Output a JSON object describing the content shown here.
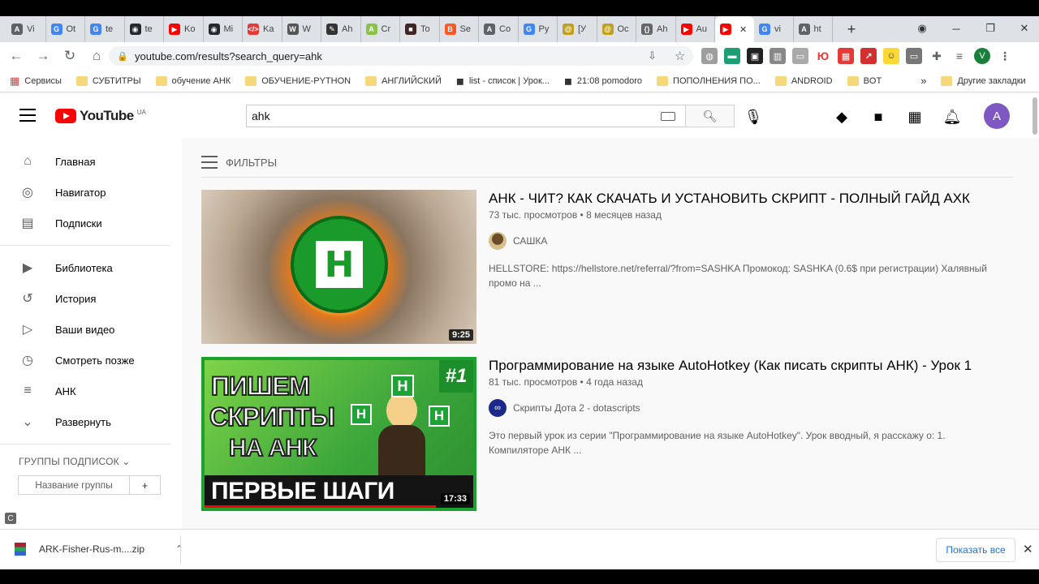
{
  "browser": {
    "tabs": [
      {
        "label": "Vi",
        "fav": "A",
        "color": "#5f6368"
      },
      {
        "label": "Ot",
        "fav": "G",
        "color": "#4285f4"
      },
      {
        "label": "te",
        "fav": "G",
        "color": "#4285f4"
      },
      {
        "label": "te",
        "fav": "◉",
        "color": "#24292e"
      },
      {
        "label": "Ko",
        "fav": "▶",
        "color": "#ff0000"
      },
      {
        "label": "Mi",
        "fav": "◉",
        "color": "#24292e"
      },
      {
        "label": "Ka",
        "fav": "</>",
        "color": "#e53935"
      },
      {
        "label": "W",
        "fav": "W",
        "color": "#555555"
      },
      {
        "label": "Ah",
        "fav": "✎",
        "color": "#333333"
      },
      {
        "label": "Cr",
        "fav": "A",
        "color": "#8bc34a"
      },
      {
        "label": "To",
        "fav": "■",
        "color": "#3e2723"
      },
      {
        "label": "Se",
        "fav": "B",
        "color": "#ff5722"
      },
      {
        "label": "Co",
        "fav": "A",
        "color": "#5f6368"
      },
      {
        "label": "Py",
        "fav": "G",
        "color": "#4285f4"
      },
      {
        "label": "[У",
        "fav": "@",
        "color": "#c0a020"
      },
      {
        "label": "Oc",
        "fav": "@",
        "color": "#c0a020"
      },
      {
        "label": "Ah",
        "fav": "{}",
        "color": "#666666"
      },
      {
        "label": "Au",
        "fav": "▶",
        "color": "#ff0000"
      },
      {
        "label": "",
        "fav": "▶",
        "color": "#ff0000",
        "active": true
      },
      {
        "label": "vi",
        "fav": "G",
        "color": "#4285f4"
      },
      {
        "label": "ht",
        "fav": "A",
        "color": "#5f6368"
      }
    ],
    "active_tab_close": "✕",
    "new_tab": "+",
    "url": "youtube.com/results?search_query=ahk",
    "profile_initial": "V",
    "bookmarks": [
      {
        "label": "Сервисы",
        "type": "apps"
      },
      {
        "label": "СУБТИТРЫ",
        "type": "folder"
      },
      {
        "label": "обучение АНК",
        "type": "folder"
      },
      {
        "label": "ОБУЧЕНИЕ-PYTHON",
        "type": "folder"
      },
      {
        "label": "АНГЛИЙСКИЙ",
        "type": "folder"
      },
      {
        "label": "list - список | Урок...",
        "type": "site"
      },
      {
        "label": "21:08 pomodoro",
        "type": "site"
      },
      {
        "label": "ПОПОЛНЕНИЯ ПО...",
        "type": "folder"
      },
      {
        "label": "ANDROID",
        "type": "folder"
      },
      {
        "label": "BOT",
        "type": "folder"
      }
    ],
    "bookmarks_more": "»",
    "other_bookmarks": "Другие закладки"
  },
  "youtube": {
    "logo_text": "YouTube",
    "logo_country": "UA",
    "search_value": "ahk",
    "avatar_initial": "A",
    "sidebar": [
      {
        "label": "Главная",
        "icon": "⌂"
      },
      {
        "label": "Навигатор",
        "icon": "◎"
      },
      {
        "label": "Подписки",
        "icon": "▤"
      },
      {
        "label": "Библиотека",
        "icon": "▶"
      },
      {
        "label": "История",
        "icon": "↺"
      },
      {
        "label": "Ваши видео",
        "icon": "▷"
      },
      {
        "label": "Смотреть позже",
        "icon": "◷"
      },
      {
        "label": "АНК",
        "icon": "≡"
      },
      {
        "label": "Развернуть",
        "icon": "⌄"
      }
    ],
    "groups_title": "ГРУППЫ ПОДПИСОК",
    "group_placeholder": "Название группы",
    "group_add": "+",
    "filters_label": "ФИЛЬТРЫ",
    "videos": [
      {
        "title": "АНК - ЧИТ? КАК СКАЧАТЬ И УСТАНОВИТЬ СКРИПТ - ПОЛНЫЙ ГАЙД АХК",
        "stats": "73 тыс. просмотров • 8 месяцев назад",
        "channel": "САШКА",
        "description": "HELLSTORE: https://hellstore.net/referral/?from=SASHKA Промокод: SASHKA (0.6$ при регистрации) Халявный промо на ...",
        "duration": "9:25",
        "thumb_letter": "H"
      },
      {
        "title": "Программирование на языке AutoHotkey (Как писать скрипты АНК) - Урок 1",
        "stats": "81 тыс. просмотров • 4 года назад",
        "channel": "Скрипты Дота 2 - dotascripts",
        "description": "Это первый урок из серии \"Программирование на языке AutoHotkey\". Урок вводный, я расскажу о: 1. Компиляторе АНК ...",
        "duration": "17:33",
        "thumb_line1": "ПИШЕМ",
        "thumb_line2": "СКРИПТЫ",
        "thumb_line3": "НА АНК",
        "thumb_bottom": "ПЕРВЫЕ ШАГИ",
        "thumb_num": "#1"
      }
    ]
  },
  "download": {
    "filename": "ARK-Fisher-Rus-m....zip",
    "show_all": "Показать все",
    "close": "✕"
  },
  "colors": {
    "yt_red": "#ff0000",
    "chrome_blue": "#1a73e8",
    "avatar_purple": "#7e57c2"
  }
}
